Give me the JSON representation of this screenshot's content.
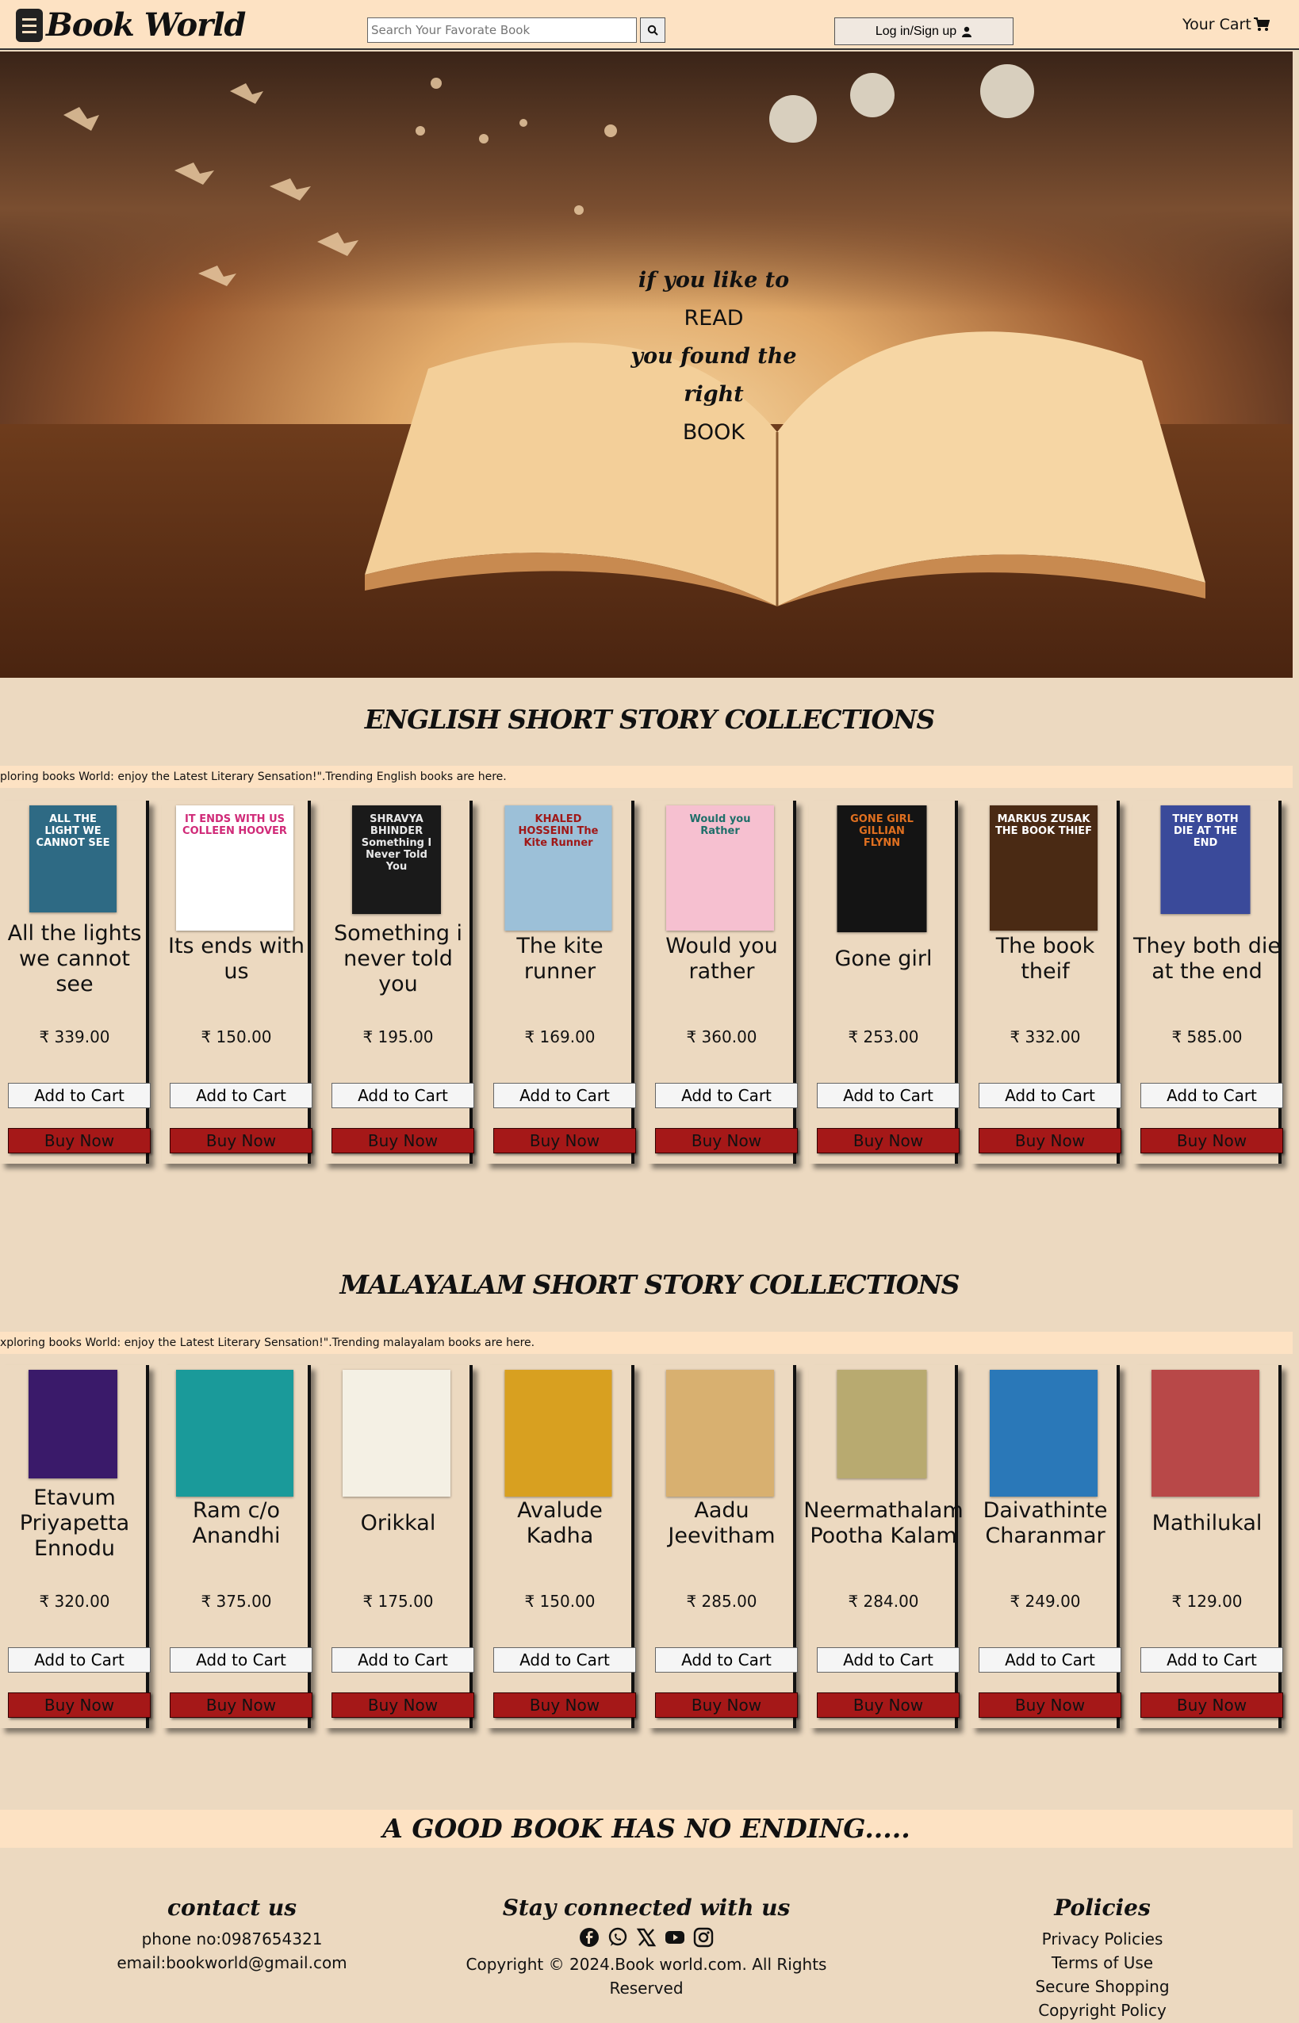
{
  "header": {
    "logo_text": "Book World",
    "search_placeholder": "Search Your Favorate Book",
    "login_label": "Log in/Sign up",
    "cart_label": "Your Cart"
  },
  "hero": {
    "line1": "if you like to",
    "line2": "READ",
    "line3": "you found the right",
    "line4": "BOOK"
  },
  "english": {
    "title": "ENGLISH SHORT STORY COLLECTIONS",
    "ticker": "ploring books World: enjoy the Latest Literary Sensation!\".Trending English books are here.",
    "books": [
      {
        "title": "All the lights we cannot see",
        "price": "₹ 339.00",
        "cover_text": "ALL THE LIGHT WE CANNOT SEE",
        "cover_bg": "#2e6a84",
        "cover_fg": "#ffffff"
      },
      {
        "title": "Its ends with us",
        "price": "₹ 150.00",
        "cover_text": "IT ENDS WITH US COLLEEN HOOVER",
        "cover_bg": "#ffffff",
        "cover_fg": "#d02a78"
      },
      {
        "title": "Something i never told you",
        "price": "₹ 195.00",
        "cover_text": "SHRAVYA BHINDER Something I Never Told You",
        "cover_bg": "#1a1a1a",
        "cover_fg": "#e8e8e8"
      },
      {
        "title": "The kite runner",
        "price": "₹ 169.00",
        "cover_text": "KHALED HOSSEINI The Kite Runner",
        "cover_bg": "#9cc0d8",
        "cover_fg": "#a01818"
      },
      {
        "title": "Would you rather",
        "price": "₹ 360.00",
        "cover_text": "Would you Rather",
        "cover_bg": "#f6c0d0",
        "cover_fg": "#1f6f6a"
      },
      {
        "title": "Gone girl",
        "price": "₹ 253.00",
        "cover_text": "GONE GIRL GILLIAN FLYNN",
        "cover_bg": "#141414",
        "cover_fg": "#e07020"
      },
      {
        "title": "The book theif",
        "price": "₹ 332.00",
        "cover_text": "MARKUS ZUSAK THE BOOK THIEF",
        "cover_bg": "#4a2a14",
        "cover_fg": "#ffffff"
      },
      {
        "title": "They both die at the end",
        "price": "₹ 585.00",
        "cover_text": "THEY BOTH DIE AT THE END",
        "cover_bg": "#3a4a9a",
        "cover_fg": "#ffffff"
      }
    ],
    "add_label": "Add to Cart",
    "buy_label": "Buy Now"
  },
  "malayalam": {
    "title": "MALAYALAM SHORT STORY COLLECTIONS",
    "ticker": "xploring books World: enjoy the Latest Literary Sensation!\".Trending malayalam books are here.",
    "books": [
      {
        "title": "Etavum Priyapetta Ennodu",
        "price": "₹ 320.00",
        "cover_text": "",
        "cover_bg": "#3a1a6a",
        "cover_fg": "#ffffff"
      },
      {
        "title": "Ram c/o Anandhi",
        "price": "₹ 375.00",
        "cover_text": "",
        "cover_bg": "#1a9a9a",
        "cover_fg": "#ffffff"
      },
      {
        "title": "Orikkal",
        "price": "₹ 175.00",
        "cover_text": "",
        "cover_bg": "#f4f0e4",
        "cover_fg": "#2a6a3a"
      },
      {
        "title": "Avalude Kadha",
        "price": "₹ 150.00",
        "cover_text": "",
        "cover_bg": "#d8a020",
        "cover_fg": "#222222"
      },
      {
        "title": "Aadu Jeevitham",
        "price": "₹ 285.00",
        "cover_text": "",
        "cover_bg": "#d8b070",
        "cover_fg": "#222222"
      },
      {
        "title": "Neermathalam Pootha Kalam",
        "price": "₹ 284.00",
        "cover_text": "",
        "cover_bg": "#b8aa70",
        "cover_fg": "#ffffff"
      },
      {
        "title": "Daivathinte Charanmar",
        "price": "₹ 249.00",
        "cover_text": "",
        "cover_bg": "#2a78b8",
        "cover_fg": "#ffffff"
      },
      {
        "title": "Mathilukal",
        "price": "₹ 129.00",
        "cover_text": "",
        "cover_bg": "#b84848",
        "cover_fg": "#ffffff"
      }
    ],
    "add_label": "Add to Cart",
    "buy_label": "Buy Now"
  },
  "banner": "A GOOD BOOK HAS NO ENDING.....",
  "footer": {
    "contact_title": "contact us",
    "phone": "phone no:0987654321",
    "email": "email:bookworld@gmail.com",
    "social_title": "Stay connected with us",
    "copyright": "Copyright © 2024.Book world.com. All Rights Reserved",
    "policies_title": "Policies",
    "policies": [
      "Privacy Policies",
      "Terms of Use",
      "Secure Shopping",
      "Copyright Policy"
    ]
  },
  "colors": {
    "accent": "#a51818",
    "header_bg": "#fde2c3",
    "page_bg": "#ecd9c0"
  }
}
